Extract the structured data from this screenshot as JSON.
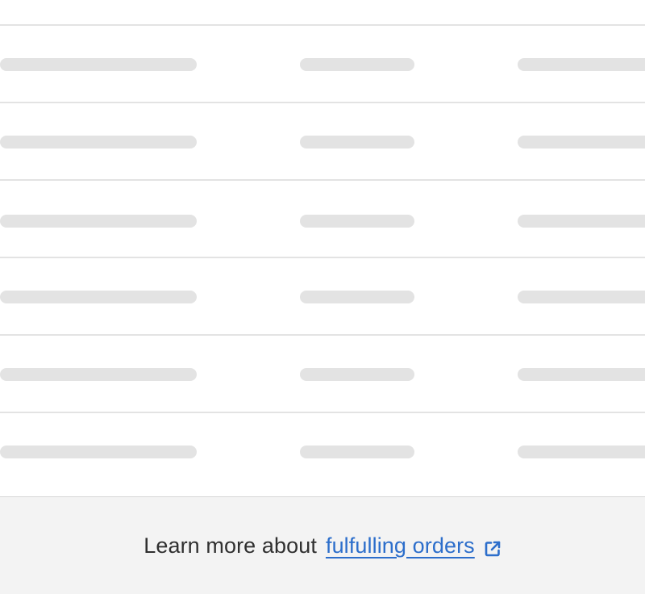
{
  "table": {
    "rows": [
      {
        "state": "loading"
      },
      {
        "state": "loading"
      },
      {
        "state": "loading"
      },
      {
        "state": "loading"
      },
      {
        "state": "loading"
      },
      {
        "state": "loading"
      }
    ]
  },
  "footer": {
    "prefix": "Learn more about",
    "link_label": "fulfulling orders",
    "link_icon": "external-link-icon"
  },
  "colors": {
    "background": "#f3f3f3",
    "card": "#ffffff",
    "skeleton": "#e3e3e3",
    "link": "#2c6ecb",
    "text": "#303030"
  }
}
